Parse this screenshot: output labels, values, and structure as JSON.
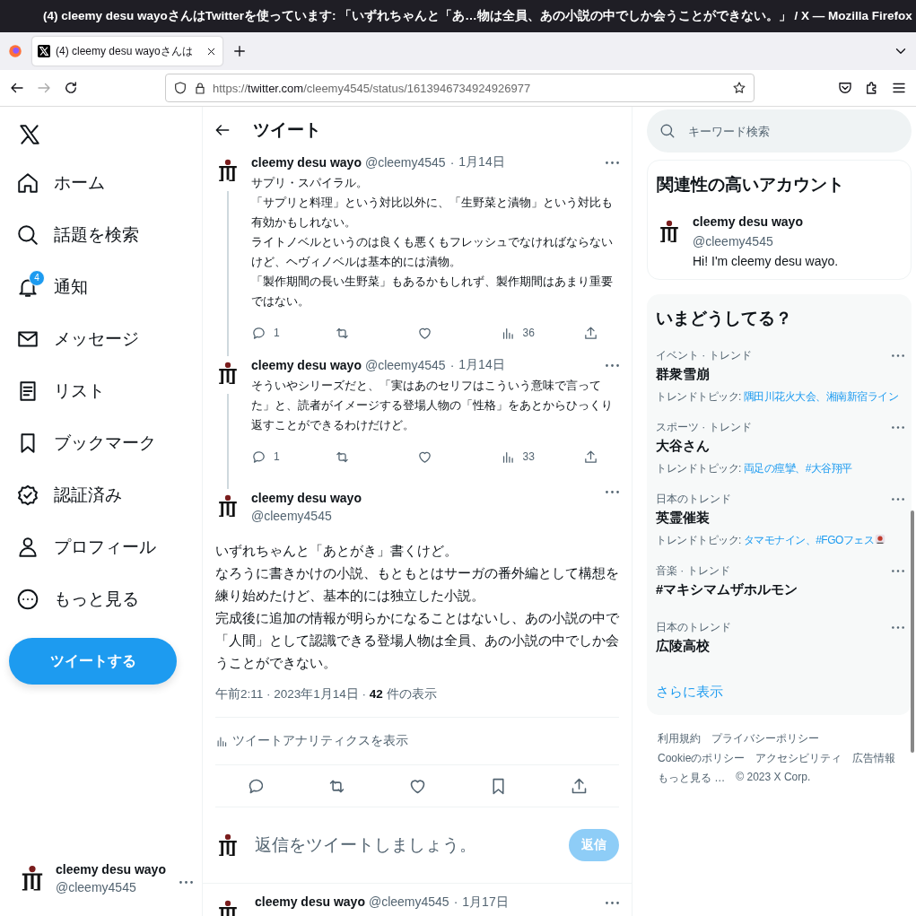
{
  "browser": {
    "window_title": "(4) cleemy desu wayoさんはTwitterを使っています: 「いずれちゃんと「あ…物は全員、あの小説の中でしか会うことができない。」 / X — Mozilla Firefox",
    "tab_title": "(4) cleemy desu wayoさんは",
    "url_scheme": "https://",
    "url_host": "twitter.com",
    "url_path": "/cleemy4545/status/1613946734924926977"
  },
  "sidebar": {
    "nav": [
      {
        "kind": "home",
        "label": "ホーム"
      },
      {
        "kind": "search",
        "label": "話題を検索"
      },
      {
        "kind": "bell",
        "label": "通知",
        "badge": "4"
      },
      {
        "kind": "mail",
        "label": "メッセージ"
      },
      {
        "kind": "list",
        "label": "リスト"
      },
      {
        "kind": "bookmark",
        "label": "ブックマーク"
      },
      {
        "kind": "verified",
        "label": "認証済み"
      },
      {
        "kind": "person",
        "label": "プロフィール"
      },
      {
        "kind": "more",
        "label": "もっと見る"
      }
    ],
    "tweet_button": "ツイートする",
    "account": {
      "name": "cleemy desu wayo",
      "handle": "@cleemy4545"
    }
  },
  "main": {
    "title": "ツイート",
    "thread": [
      {
        "name": "cleemy desu wayo",
        "handle": "@cleemy4545",
        "sep": "·",
        "date": "1月14日",
        "text": [
          "サプリ・スパイラル。",
          "「サプリと料理」という対比以外に、「生野菜と漬物」という対比も有効かもしれない。",
          "ライトノベルというのは良くも悪くもフレッシュでなければならないけど、ヘヴィノベルは基本的には漬物。",
          "「製作期間の長い生野菜」もあるかもしれず、製作期間はあまり重要ではない。"
        ],
        "replies": "1",
        "views": "36"
      },
      {
        "name": "cleemy desu wayo",
        "handle": "@cleemy4545",
        "sep": "·",
        "date": "1月14日",
        "text": [
          "そういやシリーズだと、「実はあのセリフはこういう意味で言ってた」と、読者がイメージする登場人物の「性格」をあとからひっくり返すことができるわけだけど。"
        ],
        "replies": "1",
        "views": "33"
      }
    ],
    "focus": {
      "name": "cleemy desu wayo",
      "handle": "@cleemy4545",
      "text": [
        "いずれちゃんと「あとがき」書くけど。",
        "なろうに書きかけの小説、もともとはサーガの番外編として構想を練り始めたけど、基本的には独立した小説。",
        "完成後に追加の情報が明らかになることはないし、あの小説の中で「人間」として認識できる登場人物は全員、あの小説の中でしか会うことができない。"
      ],
      "time": "午前2:11 · 2023年1月14日 · ",
      "views_count": "42",
      "views_label": " 件の表示",
      "analytics": "ツイートアナリティクスを表示"
    },
    "reply": {
      "placeholder": "返信をツイートしましょう。",
      "button": "返信"
    },
    "next": {
      "name": "cleemy desu wayo",
      "handle": "@cleemy4545",
      "sep": "·",
      "date": "1月17日"
    }
  },
  "right": {
    "search_placeholder": "キーワード検索",
    "related": {
      "title": "関連性の高いアカウント",
      "name": "cleemy desu wayo",
      "handle": "@cleemy4545",
      "bio": "Hi! I'm cleemy desu wayo."
    },
    "trends": {
      "title": "いまどうしてる？",
      "items": [
        {
          "context": "イベント · トレンド",
          "name": "群衆雪崩",
          "topics_label": "トレンドトピック: ",
          "topics": "隅田川花火大会、湘南新宿ライン",
          "emoji": false
        },
        {
          "context": "スポーツ · トレンド",
          "name": "大谷さん",
          "topics_label": "トレンドトピック: ",
          "topics": "両足の痙攣、#大谷翔平",
          "emoji": false
        },
        {
          "context": "日本のトレンド",
          "name": "英霊催装",
          "topics_label": "トレンドトピック: ",
          "topics": "タマモナイン、#FGOフェス",
          "emoji": true
        },
        {
          "context": "音楽 · トレンド",
          "name": "#マキシマムザホルモン"
        },
        {
          "context": "日本のトレンド",
          "name": "広陵高校"
        }
      ],
      "more": "さらに表示"
    },
    "footer": [
      [
        "利用規約",
        "プライバシーポリシー"
      ],
      [
        "Cookieのポリシー",
        "アクセシビリティ",
        "広告情報"
      ],
      [
        "もっと見る …",
        "© 2023 X Corp."
      ]
    ]
  }
}
